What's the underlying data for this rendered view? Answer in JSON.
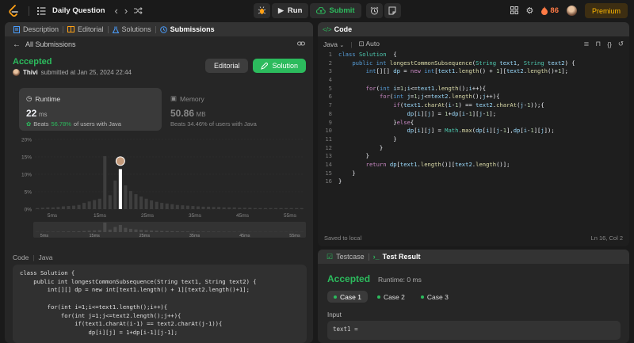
{
  "topbar": {
    "title": "Daily Question",
    "run_label": "Run",
    "submit_label": "Submit",
    "streak": "86",
    "premium_label": "Premium"
  },
  "left_tabs": [
    {
      "label": "Description",
      "icon": "document-icon"
    },
    {
      "label": "Editorial",
      "icon": "book-icon"
    },
    {
      "label": "Solutions",
      "icon": "flask-icon"
    },
    {
      "label": "Submissions",
      "icon": "history-icon"
    }
  ],
  "submission": {
    "back_label": "All Submissions",
    "status": "Accepted",
    "user": "Thivi",
    "submitted_text": "submitted at Jan 25, 2024 22:44",
    "editorial_label": "Editorial",
    "solution_label": "Solution",
    "runtime_label": "Runtime",
    "runtime_value": "22",
    "runtime_unit": "ms",
    "runtime_beats_prefix": "Beats",
    "runtime_beats_pct": "56.78%",
    "runtime_beats_suffix": "of users with Java",
    "memory_label": "Memory",
    "memory_value": "50.86",
    "memory_unit": "MB",
    "memory_beats": "Beats 34.46% of users with Java",
    "code_lang_label": "Code",
    "code_lang": "Java"
  },
  "chart_data": {
    "type": "bar",
    "y_ticks": [
      "20%",
      "15%",
      "10%",
      "5%",
      "0%"
    ],
    "ylim": [
      0,
      20
    ],
    "x_ticks": [
      "5ms",
      "15ms",
      "25ms",
      "35ms",
      "45ms",
      "55ms"
    ],
    "mini_x_ticks": [
      "5ms",
      "15ms",
      "25ms",
      "35ms",
      "45ms",
      "55ms"
    ],
    "values": [
      0.3,
      0.4,
      0.5,
      0.5,
      0.6,
      0.8,
      0.9,
      1.0,
      1.2,
      1.8,
      2.2,
      2.6,
      3.0,
      15.2,
      4.0,
      8.2,
      11.5,
      6.8,
      5.2,
      4.3,
      3.6,
      3.0,
      2.5,
      2.1,
      1.8,
      1.6,
      1.4,
      1.2,
      1.1,
      1.0,
      0.9,
      0.8,
      0.7,
      0.7,
      0.6,
      0.6,
      0.5,
      0.5,
      0.5,
      0.4,
      0.4,
      0.4,
      0.3,
      0.3,
      0.3,
      0.3,
      0.3,
      0.3,
      0.3,
      0.3,
      0.3,
      0.3
    ],
    "highlight_index": 16,
    "color": "#3e3e3e",
    "highlight_color": "#ffffff"
  },
  "editor": {
    "title": "Code",
    "language": "Java",
    "mode": "Auto",
    "saved_text": "Saved to local",
    "cursor_pos": "Ln 16, Col 2"
  },
  "code_lines": [
    [
      [
        "kw2",
        "class "
      ],
      [
        "ty",
        "Solution"
      ],
      [
        "",
        "  {"
      ]
    ],
    [
      [
        "",
        "    "
      ],
      [
        "kw2",
        "public "
      ],
      [
        "kw2",
        "int "
      ],
      [
        "fn",
        "longestCommonSubsequence"
      ],
      [
        "",
        "("
      ],
      [
        "ty",
        "String "
      ],
      [
        "var",
        "text1"
      ],
      [
        "",
        ", "
      ],
      [
        "ty",
        "String "
      ],
      [
        "var",
        "text2"
      ],
      [
        "",
        ") {"
      ]
    ],
    [
      [
        "",
        "        "
      ],
      [
        "kw2",
        "int"
      ],
      [
        "",
        "[][] "
      ],
      [
        "var",
        "dp"
      ],
      [
        "",
        " = "
      ],
      [
        "kw",
        "new "
      ],
      [
        "kw2",
        "int"
      ],
      [
        "",
        "["
      ],
      [
        "var",
        "text1"
      ],
      [
        "",
        "."
      ],
      [
        "fn",
        "length"
      ],
      [
        "",
        "() + "
      ],
      [
        "num",
        "1"
      ],
      [
        "",
        "]["
      ],
      [
        "var",
        "text2"
      ],
      [
        "",
        "."
      ],
      [
        "fn",
        "length"
      ],
      [
        "",
        "()+"
      ],
      [
        "num",
        "1"
      ],
      [
        "",
        "];"
      ]
    ],
    [
      [
        "",
        ""
      ]
    ],
    [
      [
        "",
        "        "
      ],
      [
        "kw",
        "for"
      ],
      [
        "",
        "("
      ],
      [
        "kw2",
        "int "
      ],
      [
        "var",
        "i"
      ],
      [
        "",
        "="
      ],
      [
        "num",
        "1"
      ],
      [
        "",
        ";"
      ],
      [
        "var",
        "i"
      ],
      [
        "",
        "<="
      ],
      [
        "var",
        "text1"
      ],
      [
        "",
        "."
      ],
      [
        "fn",
        "length"
      ],
      [
        "",
        "();"
      ],
      [
        "var",
        "i"
      ],
      [
        "",
        "++){"
      ]
    ],
    [
      [
        "",
        "            "
      ],
      [
        "kw",
        "for"
      ],
      [
        "",
        "("
      ],
      [
        "kw2",
        "int "
      ],
      [
        "var",
        "j"
      ],
      [
        "",
        "="
      ],
      [
        "num",
        "1"
      ],
      [
        "",
        ";"
      ],
      [
        "var",
        "j"
      ],
      [
        "",
        "<="
      ],
      [
        "var",
        "text2"
      ],
      [
        "",
        "."
      ],
      [
        "fn",
        "length"
      ],
      [
        "",
        "();"
      ],
      [
        "var",
        "j"
      ],
      [
        "",
        "++){"
      ]
    ],
    [
      [
        "",
        "                "
      ],
      [
        "kw",
        "if"
      ],
      [
        "",
        "("
      ],
      [
        "var",
        "text1"
      ],
      [
        "",
        "."
      ],
      [
        "fn",
        "charAt"
      ],
      [
        "",
        "("
      ],
      [
        "var",
        "i"
      ],
      [
        "",
        "-"
      ],
      [
        "num",
        "1"
      ],
      [
        "",
        ") == "
      ],
      [
        "var",
        "text2"
      ],
      [
        "",
        "."
      ],
      [
        "fn",
        "charAt"
      ],
      [
        "",
        "("
      ],
      [
        "var",
        "j"
      ],
      [
        "",
        "-"
      ],
      [
        "num",
        "1"
      ],
      [
        "",
        "));{"
      ]
    ],
    [
      [
        "",
        "                    "
      ],
      [
        "var",
        "dp"
      ],
      [
        "",
        "["
      ],
      [
        "var",
        "i"
      ],
      [
        "",
        "]["
      ],
      [
        "var",
        "j"
      ],
      [
        "",
        "] = "
      ],
      [
        "num",
        "1"
      ],
      [
        "",
        "+"
      ],
      [
        "var",
        "dp"
      ],
      [
        "",
        "["
      ],
      [
        "var",
        "i"
      ],
      [
        "",
        "-"
      ],
      [
        "num",
        "1"
      ],
      [
        "",
        "]["
      ],
      [
        "var",
        "j"
      ],
      [
        "",
        "-"
      ],
      [
        "num",
        "1"
      ],
      [
        "",
        "];"
      ]
    ],
    [
      [
        "",
        "                }"
      ],
      [
        "kw",
        "else"
      ],
      [
        "",
        "{"
      ]
    ],
    [
      [
        "",
        "                    "
      ],
      [
        "var",
        "dp"
      ],
      [
        "",
        "["
      ],
      [
        "var",
        "i"
      ],
      [
        "",
        "]["
      ],
      [
        "var",
        "j"
      ],
      [
        "",
        "] = "
      ],
      [
        "ty",
        "Math"
      ],
      [
        "",
        "."
      ],
      [
        "fn",
        "max"
      ],
      [
        "",
        "("
      ],
      [
        "var",
        "dp"
      ],
      [
        "",
        "["
      ],
      [
        "var",
        "i"
      ],
      [
        "",
        "]["
      ],
      [
        "var",
        "j"
      ],
      [
        "",
        "-"
      ],
      [
        "num",
        "1"
      ],
      [
        "",
        "],"
      ],
      [
        "var",
        "dp"
      ],
      [
        "",
        "["
      ],
      [
        "var",
        "i"
      ],
      [
        "",
        "-"
      ],
      [
        "num",
        "1"
      ],
      [
        "",
        "]["
      ],
      [
        "var",
        "j"
      ],
      [
        "",
        "]);"
      ]
    ],
    [
      [
        "",
        "                }"
      ]
    ],
    [
      [
        "",
        "            }"
      ]
    ],
    [
      [
        "",
        "        }"
      ]
    ],
    [
      [
        "",
        "        "
      ],
      [
        "kw",
        "return "
      ],
      [
        "var",
        "dp"
      ],
      [
        "",
        "["
      ],
      [
        "var",
        "text1"
      ],
      [
        "",
        "."
      ],
      [
        "fn",
        "length"
      ],
      [
        "",
        "()]["
      ],
      [
        "var",
        "text2"
      ],
      [
        "",
        "."
      ],
      [
        "fn",
        "length"
      ],
      [
        "",
        "()];"
      ]
    ],
    [
      [
        "",
        "    }"
      ]
    ],
    [
      [
        "",
        "}"
      ]
    ]
  ],
  "bottom_code": [
    "class Solution {",
    "    public int longestCommonSubsequence(String text1, String text2) {",
    "        int[][] dp = new int[text1.length() + 1][text2.length()+1];",
    "",
    "        for(int i=1;i<=text1.length();i++){",
    "            for(int j=1;j<=text2.length();j++){",
    "                if(text1.charAt(i-1) == text2.charAt(j-1)){",
    "                    dp[i][j] = 1+dp[i-1][j-1];"
  ],
  "testpanel": {
    "tab_testcase": "Testcase",
    "tab_result": "Test Result",
    "status": "Accepted",
    "runtime": "Runtime: 0 ms",
    "cases": [
      "Case 1",
      "Case 2",
      "Case 3"
    ],
    "input_label": "Input",
    "input_var": "text1 ="
  }
}
